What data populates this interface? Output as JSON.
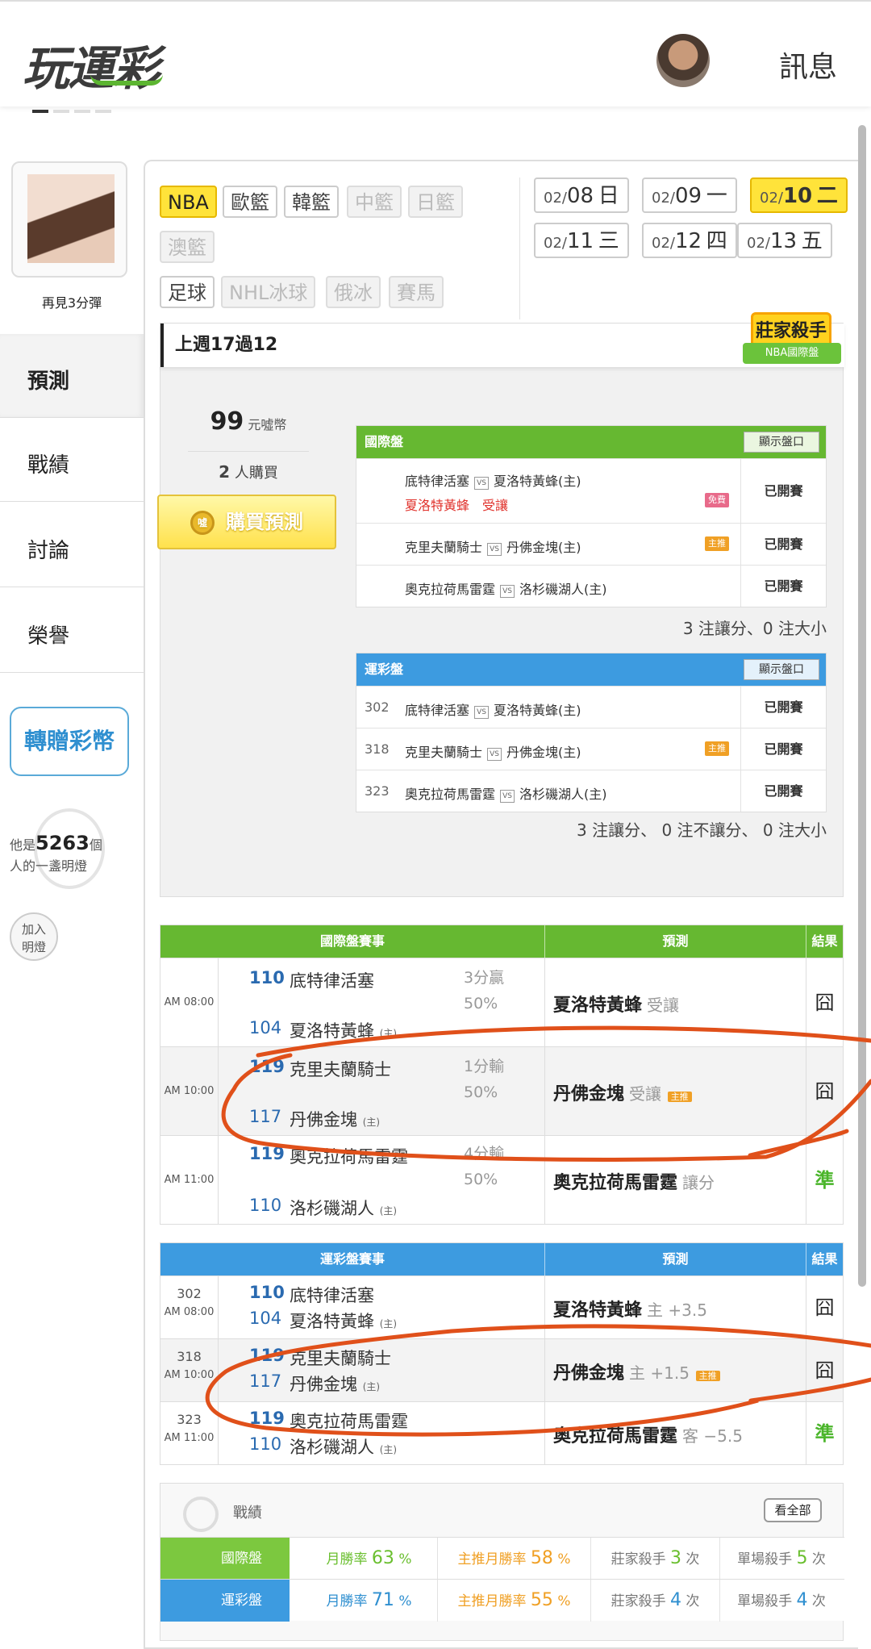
{
  "header": {
    "logo": "玩運彩",
    "messages": "訊息"
  },
  "sidebar": {
    "username": "再見3分彈",
    "nav": [
      "預測",
      "戰績",
      "討論",
      "榮譽"
    ],
    "gift_button": "轉贈彩幣",
    "lamp_prefix": "他是",
    "lamp_count": "5263",
    "lamp_suffix": "個",
    "lamp_line2": "人的一盞明燈",
    "join_line1": "加入",
    "join_line2": "明燈"
  },
  "tabs": {
    "nba": "NBA",
    "euro": "歐籃",
    "korea": "韓籃",
    "china": "中籃",
    "japan": "日籃",
    "aus": "澳籃",
    "soccer": "足球",
    "nhl": "NHL冰球",
    "russia": "俄冰",
    "horse": "賽馬"
  },
  "dates": [
    {
      "md": "02/",
      "d": "08",
      "w": "日"
    },
    {
      "md": "02/",
      "d": "09",
      "w": "一"
    },
    {
      "md": "02/",
      "d": "10",
      "w": "二"
    },
    {
      "md": "02/",
      "d": "11",
      "w": "三"
    },
    {
      "md": "02/",
      "d": "12",
      "w": "四"
    },
    {
      "md": "02/",
      "d": "13",
      "w": "五"
    }
  ],
  "prediction": {
    "title": "上週17過12",
    "badge_top": "莊家殺手",
    "badge_bottom": "NBA國際盤",
    "price": "99",
    "price_unit": "元噓幣",
    "buyers_count": "2",
    "buyers_label": "人購買",
    "buy_button": "購買預測",
    "coin_label": "噓"
  },
  "intl_panel": {
    "title": "國際盤",
    "show_button": "顯示盤口",
    "vs": "VS",
    "rows": [
      {
        "away": "底特律活塞",
        "home": "夏洛特黃蜂(主)",
        "pick": "夏洛特黃蜂　受讓",
        "tag": "免費",
        "status": "已開賽"
      },
      {
        "away": "克里夫蘭騎士",
        "home": "丹佛金塊(主)",
        "tag": "主推",
        "status": "已開賽"
      },
      {
        "away": "奧克拉荷馬雷霆",
        "home": "洛杉磯湖人(主)",
        "status": "已開賽"
      }
    ],
    "summary": "3 注讓分、0 注大小"
  },
  "lottery_panel": {
    "title": "運彩盤",
    "show_button": "顯示盤口",
    "vs": "VS",
    "rows": [
      {
        "code": "302",
        "away": "底特律活塞",
        "home": "夏洛特黃蜂(主)",
        "status": "已開賽"
      },
      {
        "code": "318",
        "away": "克里夫蘭騎士",
        "home": "丹佛金塊(主)",
        "tag": "主推",
        "status": "已開賽"
      },
      {
        "code": "323",
        "away": "奧克拉荷馬雷霆",
        "home": "洛杉磯湖人(主)",
        "status": "已開賽"
      }
    ],
    "summary": "3 注讓分、 0 注不讓分、 0 注大小"
  },
  "intl_results": {
    "headers": {
      "match": "國際盤賽事",
      "pred": "預測",
      "result": "結果"
    },
    "home_mark": "(主)",
    "rows": [
      {
        "time": "AM 08:00",
        "s1": "110",
        "t1": "底特律活塞",
        "s2": "104",
        "t2": "夏洛特黃蜂",
        "odds1": "3分贏",
        "odds2": "50%",
        "pick": "夏洛特黃蜂",
        "note": "受讓",
        "result": "囧"
      },
      {
        "time": "AM 10:00",
        "s1": "119",
        "t1": "克里夫蘭騎士",
        "s2": "117",
        "t2": "丹佛金塊",
        "odds1": "1分輸",
        "odds2": "50%",
        "pick": "丹佛金塊",
        "note": "受讓",
        "tag": "主推",
        "result": "囧"
      },
      {
        "time": "AM 11:00",
        "s1": "119",
        "t1": "奧克拉荷馬雷霆",
        "s2": "110",
        "t2": "洛杉磯湖人",
        "odds1": "4分輸",
        "odds2": "50%",
        "pick": "奧克拉荷馬雷霆",
        "note": "讓分",
        "result": "準"
      }
    ]
  },
  "lottery_results": {
    "headers": {
      "match": "運彩盤賽事",
      "pred": "預測",
      "result": "結果"
    },
    "home_mark": "(主)",
    "rows": [
      {
        "code": "302",
        "time": "AM 08:00",
        "s1": "110",
        "t1": "底特律活塞",
        "s2": "104",
        "t2": "夏洛特黃蜂",
        "pick": "夏洛特黃蜂",
        "note": "主 +3.5",
        "result": "囧"
      },
      {
        "code": "318",
        "time": "AM 10:00",
        "s1": "119",
        "t1": "克里夫蘭騎士",
        "s2": "117",
        "t2": "丹佛金塊",
        "pick": "丹佛金塊",
        "note": "主 +1.5",
        "tag": "主推",
        "result": "囧"
      },
      {
        "code": "323",
        "time": "AM 11:00",
        "s1": "119",
        "t1": "奧克拉荷馬雷霆",
        "s2": "110",
        "t2": "洛杉磯湖人",
        "pick": "奧克拉荷馬雷霆",
        "note": "客 −5.5",
        "result": "準"
      }
    ]
  },
  "record": {
    "title": "戰績",
    "see_all": "看全部",
    "rows": [
      {
        "label": "國際盤",
        "c1_label": "月勝率",
        "c1_val": "63",
        "c2_label": "主推月勝率",
        "c2_val": "58",
        "pct": "%",
        "c3_label": "莊家殺手",
        "c3_val": "3",
        "c4_label": "單場殺手",
        "c4_val": "5",
        "times": "次"
      },
      {
        "label": "運彩盤",
        "c1_label": "月勝率",
        "c1_val": "71",
        "c2_label": "主推月勝率",
        "c2_val": "55",
        "pct": "%",
        "c3_label": "莊家殺手",
        "c3_val": "4",
        "c4_label": "單場殺手",
        "c4_val": "4",
        "times": "次"
      }
    ]
  },
  "colors": {
    "intl": "#66b831",
    "lottery": "#3d9be0",
    "highlight": "#ffe33a",
    "annotation": "#e0501a"
  }
}
